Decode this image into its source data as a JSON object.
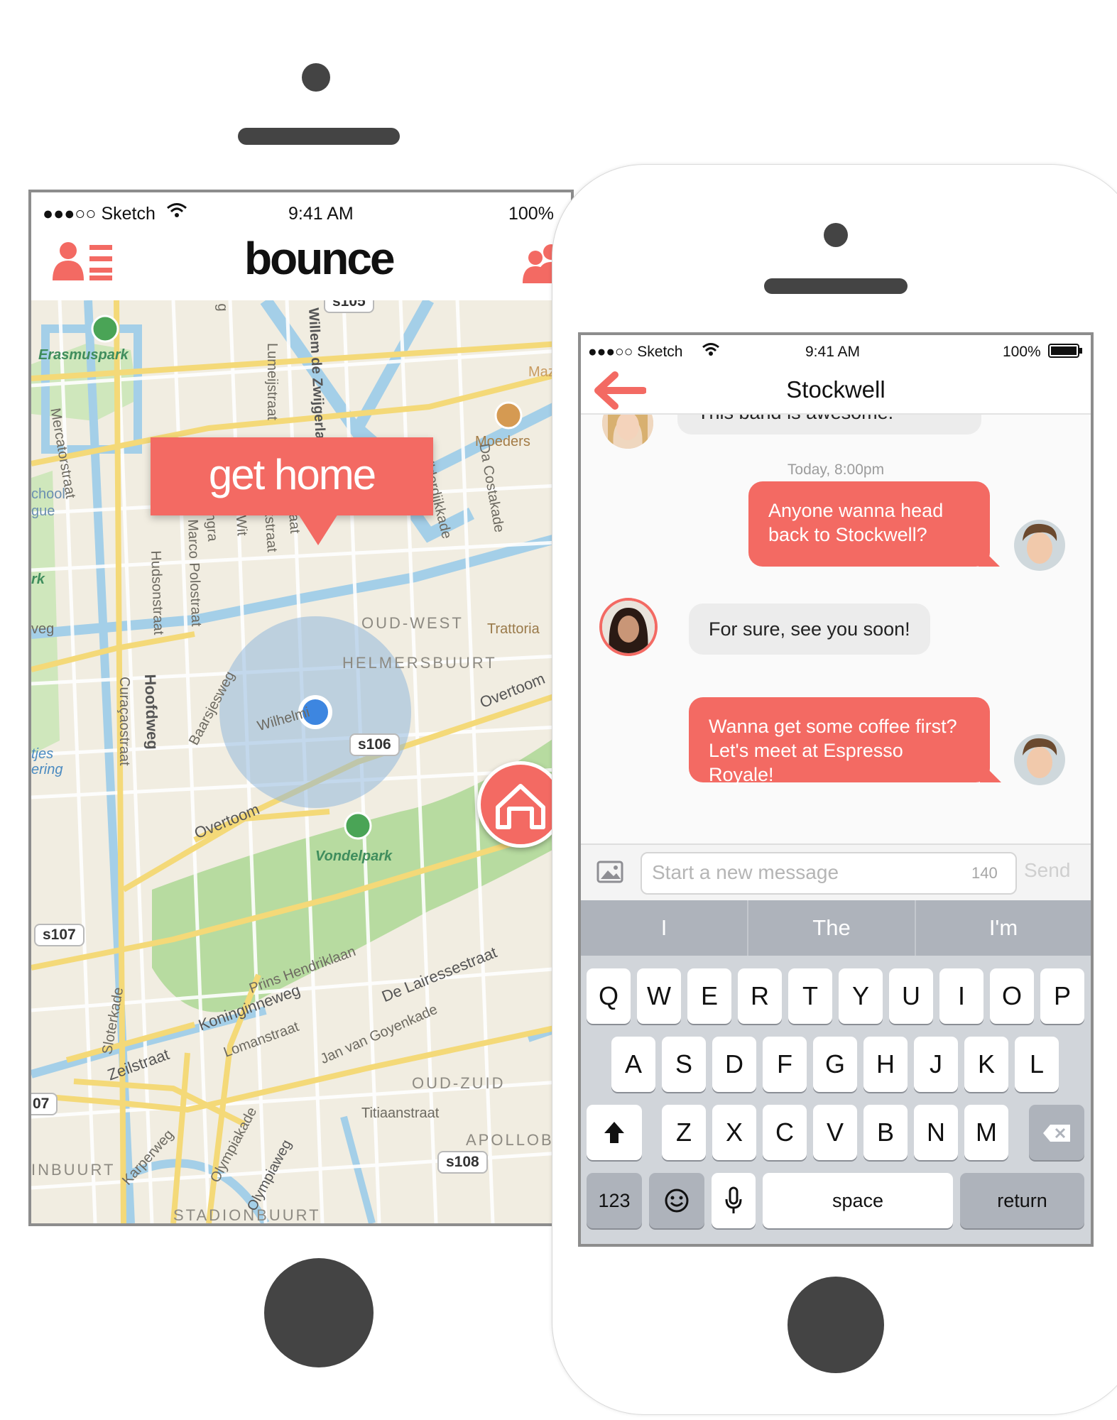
{
  "left_phone": {
    "status": {
      "carrier": "●●●○○ Sketch",
      "time": "9:41 AM",
      "battery": "100%"
    },
    "app_title": "bounce",
    "map_labels": {
      "erasmuspark": "Erasmuspark",
      "maz": "Maz",
      "moeders": "Moeders",
      "mercatorstraat": "Mercatorstraat",
      "school": "chool",
      "gue": "gue",
      "rk": "rk",
      "veg": "veg",
      "lumeijstraat": "Lumeijstraat",
      "zwijgerlaan": "Willem de Zwijgerlaan",
      "admiralengracht": "Admiralengra",
      "witte_de_with": "Witte De Wit",
      "van_speijk": "Van Speijkstraat",
      "chassestraat": "Chassestraat",
      "bilderdijkkade": "Bilderdijkkade",
      "da_costakade": "Da Costakade",
      "marco_polostraat": "Marco Polostraat",
      "hudsonstraat": "Hudsonstraat",
      "oud_west": "OUD-WEST",
      "trattoria": "Trattoria",
      "helmersbuurt": "HELMERSBUURT",
      "overtoom_1": "Overtoom",
      "baarsjesweg": "Baarsjesweg",
      "wilhelmina": "Wilhelmi",
      "curacaostraat": "Curaçaostraat",
      "hoofdweg": "Hoofdweg",
      "tjes": "tjes",
      "ering": "ering",
      "overtoom_2": "Overtoom",
      "vondelpark": "Vondelpark",
      "prins_hendriklaan": "Prins Hendriklaan",
      "koninginneweg": "Koninginneweg",
      "de_lairessestraat": "De Lairessestraat",
      "lomanstraat": "Lomanstraat",
      "jan_van_goyenkade": "Jan van Goyenkade",
      "sloterkade": "Sloterkade",
      "zeilstraat": "Zeilstraat",
      "oud_zuid": "OUD-ZUID",
      "titiaanstraat": "Titiaanstraat",
      "apollob": "APOLLOB",
      "inbuurt": "INBUURT",
      "karperweg": "Karperweg",
      "olympiakade": "Olympiakade",
      "olympiaweg": "Olympiaweg",
      "stadionbuurt": "STADIONBUURT",
      "seven": "07",
      "s105": "s105",
      "s106": "s106",
      "s107": "s107",
      "s108": "s108",
      "g": "g"
    },
    "callout": "get home",
    "colors": {
      "accent": "#f36a63",
      "location": "#3d86e0",
      "park": "#b7dba0",
      "water": "#a4cfe8",
      "major_road": "#f4d978"
    }
  },
  "right_phone": {
    "status": {
      "carrier": "●●●○○ Sketch",
      "time": "9:41 AM",
      "battery": "100%"
    },
    "title": "Stockwell",
    "messages": [
      {
        "from": "them",
        "text": "This band is awesome."
      },
      {
        "type": "timestamp",
        "text": "Today, 8:00pm"
      },
      {
        "from": "me",
        "line1": "Anyone wanna head",
        "line2": "back to Stockwell?"
      },
      {
        "from": "them",
        "text": "For sure, see you soon!"
      },
      {
        "from": "me",
        "line1": "Wanna get some coffee first?",
        "line2": "Let's meet at Espresso Royale!"
      }
    ],
    "composer": {
      "placeholder": "Start a new message",
      "char_count": "140",
      "send_label": "Send"
    },
    "keyboard": {
      "suggestions": [
        "I",
        "The",
        "I'm"
      ],
      "row1": [
        "Q",
        "W",
        "E",
        "R",
        "T",
        "Y",
        "U",
        "I",
        "O",
        "P"
      ],
      "row2": [
        "A",
        "S",
        "D",
        "F",
        "G",
        "H",
        "J",
        "K",
        "L"
      ],
      "row3": [
        "Z",
        "X",
        "C",
        "V",
        "B",
        "N",
        "M"
      ],
      "numbers_label": "123",
      "space_label": "space",
      "return_label": "return"
    }
  }
}
